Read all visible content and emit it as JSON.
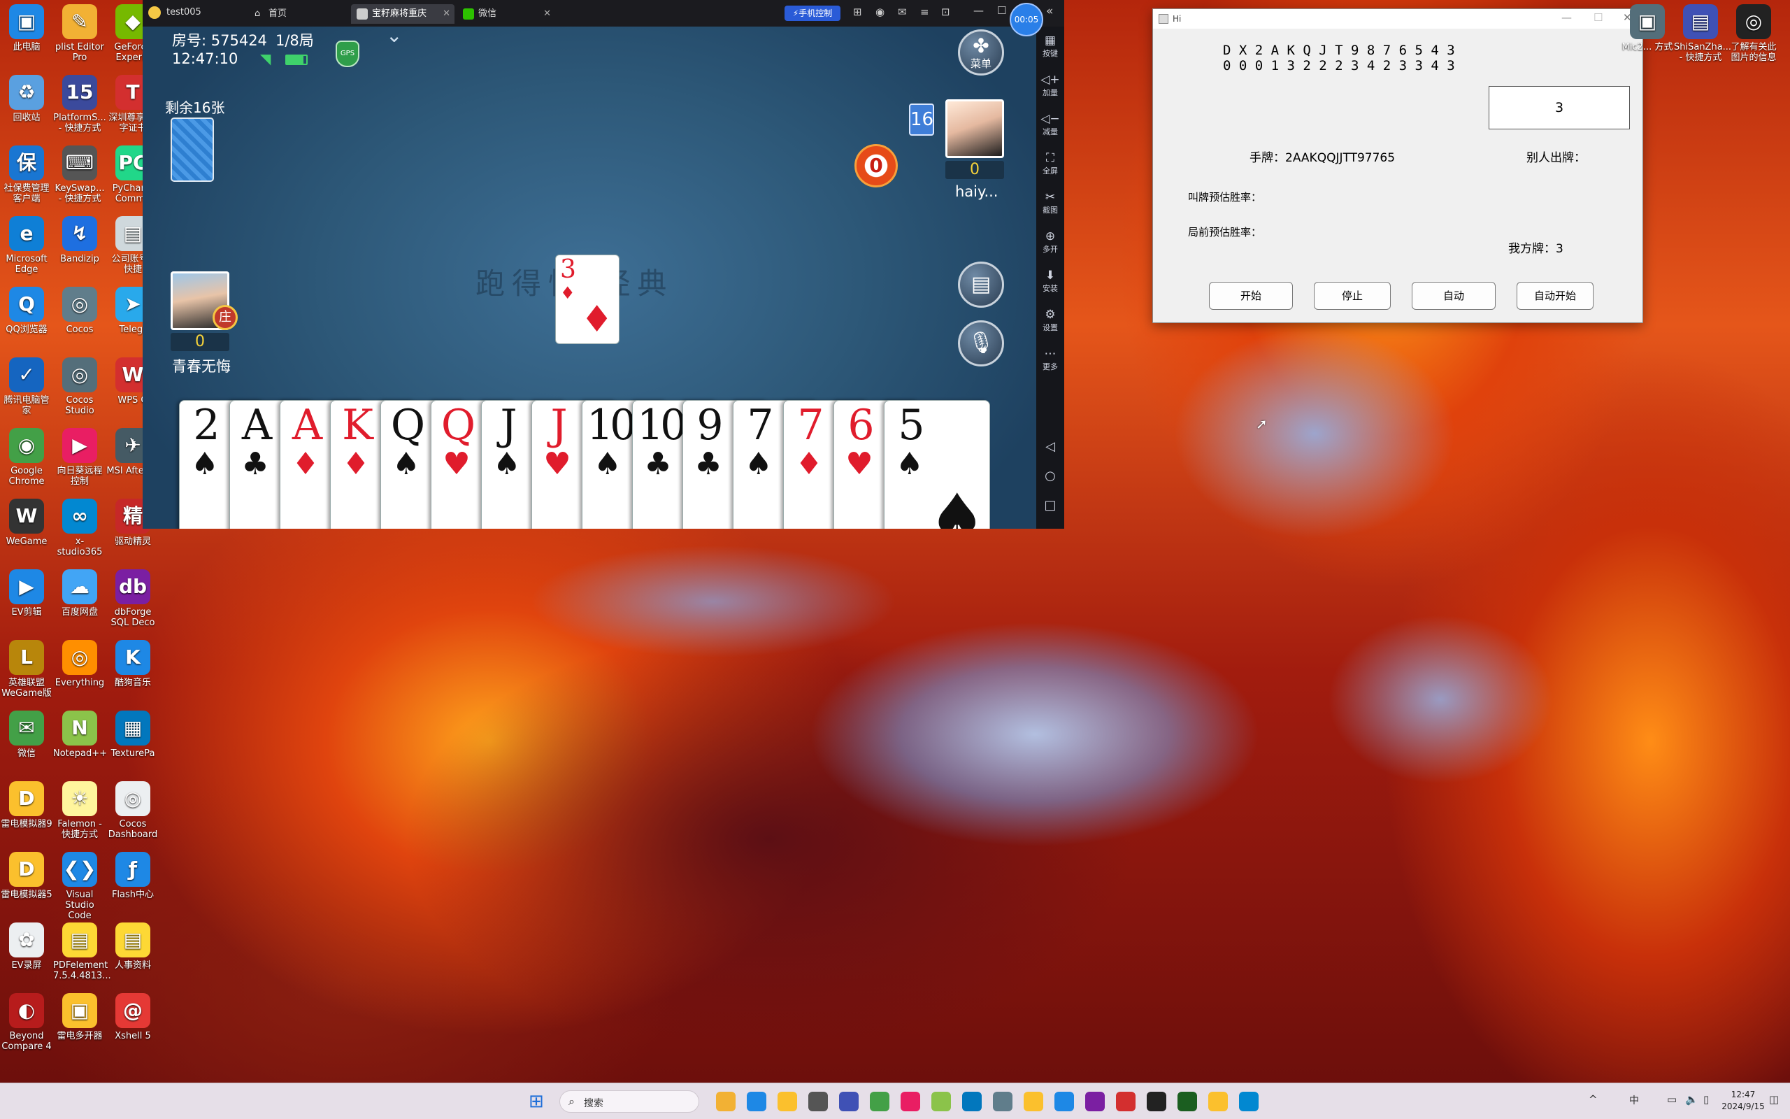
{
  "desktop": {
    "icons": [
      {
        "label": "此电脑",
        "color": "#1e88e5",
        "glyph": "▣"
      },
      {
        "label": "plist Editor Pro",
        "color": "#f2b134",
        "glyph": "✎"
      },
      {
        "label": "GeForce Experie",
        "color": "#76b900",
        "glyph": "◆"
      },
      {
        "label": "回收站",
        "color": "#5aa0e0",
        "glyph": "♻"
      },
      {
        "label": "PlatformS... - 快捷方式",
        "color": "#3b4a9c",
        "glyph": "15"
      },
      {
        "label": "深圳尊享 数字证书",
        "color": "#d32f2f",
        "glyph": "T"
      },
      {
        "label": "社保费管理客户端",
        "color": "#1976d2",
        "glyph": "保"
      },
      {
        "label": "KeySwap... - 快捷方式",
        "color": "#555",
        "glyph": "⌨"
      },
      {
        "label": "PyCharm Commu",
        "color": "#21d789",
        "glyph": "PC"
      },
      {
        "label": "Microsoft Edge",
        "color": "#0f7fd6",
        "glyph": "e"
      },
      {
        "label": "Bandizip",
        "color": "#1e6fe0",
        "glyph": "↯"
      },
      {
        "label": "公司账号 - 快捷",
        "color": "#cfd8dc",
        "glyph": "▤"
      },
      {
        "label": "QQ浏览器",
        "color": "#1e88e5",
        "glyph": "Q"
      },
      {
        "label": "Cocos",
        "color": "#607d8b",
        "glyph": "◎"
      },
      {
        "label": "Telegr",
        "color": "#29a9eb",
        "glyph": "➤"
      },
      {
        "label": "腾讯电脑管家",
        "color": "#1565c0",
        "glyph": "✓"
      },
      {
        "label": "Cocos Studio",
        "color": "#546e7a",
        "glyph": "◎"
      },
      {
        "label": "WPS O",
        "color": "#d32f2f",
        "glyph": "W"
      },
      {
        "label": "Google Chrome",
        "color": "#43a047",
        "glyph": "◉"
      },
      {
        "label": "向日葵远程控制",
        "color": "#e91e63",
        "glyph": "▶"
      },
      {
        "label": "MSI Afterbu",
        "color": "#455a64",
        "glyph": "✈"
      },
      {
        "label": "WeGame",
        "color": "#333",
        "glyph": "W"
      },
      {
        "label": "x-studio365",
        "color": "#0288d1",
        "glyph": "∞"
      },
      {
        "label": "驱动精灵",
        "color": "#c62828",
        "glyph": "精"
      },
      {
        "label": "EV剪辑",
        "color": "#1e88e5",
        "glyph": "▶"
      },
      {
        "label": "百度网盘",
        "color": "#42a5f5",
        "glyph": "☁"
      },
      {
        "label": "dbForge SQL Deco",
        "color": "#7b1fa2",
        "glyph": "db"
      },
      {
        "label": "英雄联盟WeGame版",
        "color": "#b8860b",
        "glyph": "L"
      },
      {
        "label": "Everything",
        "color": "#ff8f00",
        "glyph": "◎"
      },
      {
        "label": "酷狗音乐",
        "color": "#1e88e5",
        "glyph": "K"
      },
      {
        "label": "微信",
        "color": "#43a047",
        "glyph": "✉"
      },
      {
        "label": "Notepad++",
        "color": "#8bc34a",
        "glyph": "N"
      },
      {
        "label": "TexturePa",
        "color": "#0277bd",
        "glyph": "▦"
      },
      {
        "label": "雷电模拟器9",
        "color": "#fbc02d",
        "glyph": "D"
      },
      {
        "label": "Falemon - 快捷方式",
        "color": "#fff59d",
        "glyph": "☀"
      },
      {
        "label": "Cocos Dashboard",
        "color": "#eceff1",
        "glyph": "◎"
      },
      {
        "label": "雷电模拟器5",
        "color": "#fbc02d",
        "glyph": "D"
      },
      {
        "label": "Visual Studio Code",
        "color": "#1e88e5",
        "glyph": "❮❯"
      },
      {
        "label": "Flash中心",
        "color": "#1e88e5",
        "glyph": "ƒ"
      },
      {
        "label": "EV录屏",
        "color": "#eceff1",
        "glyph": "✿"
      },
      {
        "label": "PDFelement 7.5.4.4813...",
        "color": "#fdd835",
        "glyph": "▤"
      },
      {
        "label": "人事资料",
        "color": "#fdd835",
        "glyph": "▤"
      },
      {
        "label": "Beyond Compare 4",
        "color": "#b71c1c",
        "glyph": "◐"
      },
      {
        "label": "雷电多开器",
        "color": "#fbc02d",
        "glyph": "▣"
      },
      {
        "label": "Xshell 5",
        "color": "#e53935",
        "glyph": "@"
      },
      {
        "label": "Mic2... 方式",
        "color": "#546e7a",
        "glyph": "▣"
      },
      {
        "label": "ShiSanZha... - 快捷方式",
        "color": "#3f51b5",
        "glyph": "▤"
      },
      {
        "label": "了解有关此图片的信息",
        "color": "#222",
        "glyph": "◎"
      }
    ]
  },
  "emulator": {
    "window_title": "test005",
    "tabs": [
      "首页",
      "宝籽麻将重庆",
      "微信"
    ],
    "control_button": "手机控制",
    "timer_badge": "00:05",
    "sidebar": [
      "按键",
      "加量",
      "减量",
      "全屏",
      "截图",
      "多开",
      "安装",
      "设置",
      "更多"
    ]
  },
  "game": {
    "room": "房号: 575424",
    "round": "1/8局",
    "time": "12:47:10",
    "gps": "GPS",
    "remaining": "剩余16张",
    "menu": "菜单",
    "opponent_count": "16",
    "opponent_score": "0",
    "opponent_name": "haiy...",
    "alarm": "0",
    "played_card": {
      "rank": "3",
      "suit": "♦"
    },
    "table_logo": "跑得快 经典",
    "self_score": "0",
    "self_name": "青春无悔",
    "self_badge": "庄",
    "hand": [
      {
        "rank": "2",
        "suit": "♠",
        "color": "blk"
      },
      {
        "rank": "A",
        "suit": "♣",
        "color": "blk"
      },
      {
        "rank": "A",
        "suit": "♦",
        "color": "red"
      },
      {
        "rank": "K",
        "suit": "♦",
        "color": "red"
      },
      {
        "rank": "Q",
        "suit": "♠",
        "color": "blk"
      },
      {
        "rank": "Q",
        "suit": "♥",
        "color": "red"
      },
      {
        "rank": "J",
        "suit": "♠",
        "color": "blk"
      },
      {
        "rank": "J",
        "suit": "♥",
        "color": "red"
      },
      {
        "rank": "10",
        "suit": "♠",
        "color": "blk"
      },
      {
        "rank": "10",
        "suit": "♣",
        "color": "blk"
      },
      {
        "rank": "9",
        "suit": "♣",
        "color": "blk"
      },
      {
        "rank": "7",
        "suit": "♠",
        "color": "blk"
      },
      {
        "rank": "7",
        "suit": "♦",
        "color": "red"
      },
      {
        "rank": "6",
        "suit": "♥",
        "color": "red"
      },
      {
        "rank": "5",
        "suit": "♠",
        "color": "blk"
      }
    ]
  },
  "helper": {
    "title": "Hi",
    "rank_header": "D X 2 A K Q J T 9 8 7 6 5 4 3",
    "rank_counts": "0 0 0 1 3 2 2 2 3 4 2 3 3 4 3",
    "input_value": "3",
    "hand_label": "手牌：2AAKQQJJTT97765",
    "others_label": "别人出牌：",
    "bid_rate_label": "叫牌预估胜率：",
    "pre_rate_label": "局前预估胜率：",
    "my_play_label": "我方牌：3",
    "buttons": [
      "开始",
      "停止",
      "自动",
      "自动开始"
    ]
  },
  "taskbar": {
    "search": "搜索",
    "clock_time": "12:47",
    "clock_date": "2024/9/15",
    "ime": "中"
  }
}
